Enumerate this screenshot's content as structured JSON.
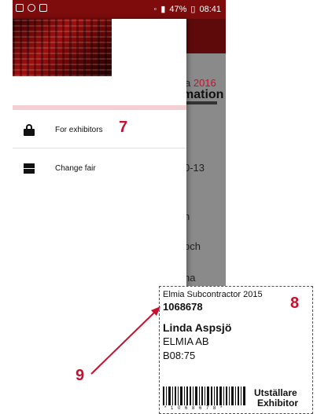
{
  "status_bar": {
    "battery": "47%",
    "time": "08:41",
    "icons": [
      "gallery-icon",
      "sync-icon",
      "briefcase-icon",
      "wifi-icon",
      "signal-icon",
      "battery-icon"
    ]
  },
  "behind_content": {
    "logo_year": "2016",
    "logo_word": "mation",
    "lines": [
      "a",
      "0-13",
      "n",
      "och",
      "na"
    ]
  },
  "drawer": {
    "items": [
      {
        "label": "For exhibitors",
        "icon": "lock-icon"
      },
      {
        "label": "Change fair",
        "icon": "change-fair-icon"
      }
    ]
  },
  "annotations": {
    "n7": "7",
    "n8": "8",
    "n9": "9"
  },
  "badge": {
    "event": "Elmia Subcontractor 2015",
    "id": "1068678",
    "name": "Linda Aspsjö",
    "company": "ELMIA AB",
    "booth": "B08:75",
    "barcode_text": "* 1 0 6 8 6 7 8 *",
    "role_sv": "Utställare",
    "role_en": "Exhibitor"
  },
  "colors": {
    "status_bar": "#7e0c0c",
    "accent_red": "#c8102e",
    "header_stripe": "#f4cfd3"
  }
}
